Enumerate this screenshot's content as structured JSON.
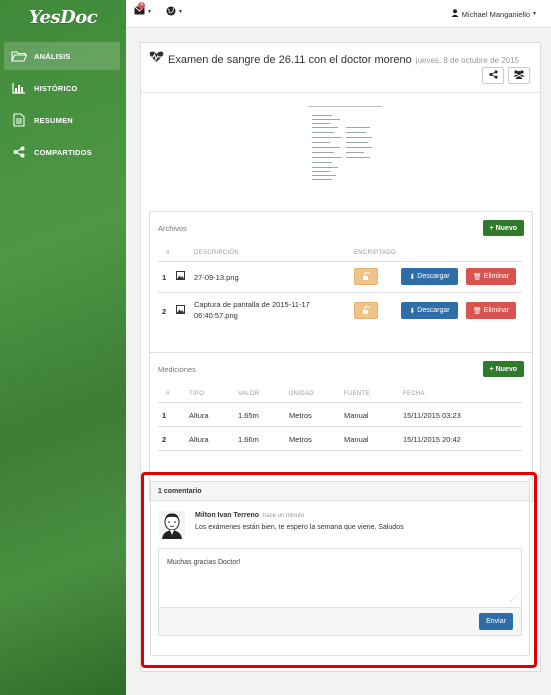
{
  "app": {
    "logo": "YesDoc"
  },
  "sidebar": {
    "items": [
      {
        "label": "ANÁLISIS",
        "icon": "folder-open-icon",
        "active": true
      },
      {
        "label": "HISTÓRICO",
        "icon": "bar-chart-icon",
        "active": false
      },
      {
        "label": "RESUMEN",
        "icon": "document-icon",
        "active": false
      },
      {
        "label": "COMPARTIDOS",
        "icon": "share-icon",
        "active": false
      }
    ]
  },
  "topbar": {
    "mail_badge": "4",
    "user_name": "Michael Manganiello"
  },
  "exam": {
    "title": "Examen de sangre de 26.11 con el doctor moreno",
    "date": "jueves, 8 de octubre de 2015"
  },
  "files": {
    "title": "Archivos",
    "new_label": "Nuevo",
    "headers": {
      "num": "#",
      "description": "DESCRIPCIÓN",
      "encrypted": "ENCRIPTADO"
    },
    "rows": [
      {
        "num": "1",
        "description": "27-09-13.png"
      },
      {
        "num": "2",
        "description": "Captura de pantalla de 2015-11-17",
        "description2": "06:40:57.png"
      }
    ],
    "download_label": "Descargar",
    "delete_label": "Eliminar"
  },
  "measurements": {
    "title": "Mediciones",
    "new_label": "Nuevo",
    "headers": {
      "num": "#",
      "type": "TIPO",
      "value": "VALOR",
      "unit": "UNIDAD",
      "source": "FUENTE",
      "date": "FECHA"
    },
    "rows": [
      {
        "num": "1",
        "type": "Altura",
        "value": "1.65m",
        "unit": "Metros",
        "source": "Manual",
        "date": "15/11/2015 03:23"
      },
      {
        "num": "2",
        "type": "Altura",
        "value": "1.66m",
        "unit": "Metros",
        "source": "Manual",
        "date": "15/11/2015 20:42"
      }
    ]
  },
  "comments": {
    "count_label": "1 comentario",
    "items": [
      {
        "author": "Milton Ivan Terreno",
        "time": "hace un minuto",
        "text": "Los exámenes están bien, te espero la semana que viene. Saludos"
      }
    ],
    "reply_value": "Muchas gracias Doctor!",
    "send_label": "Enviar"
  },
  "colors": {
    "sidebar": "#3f8a3a",
    "primary": "#2d6ea8",
    "success": "#2f7a2b",
    "danger": "#d9534f",
    "warning": "#f0c38a",
    "highlight": "#e00000"
  }
}
